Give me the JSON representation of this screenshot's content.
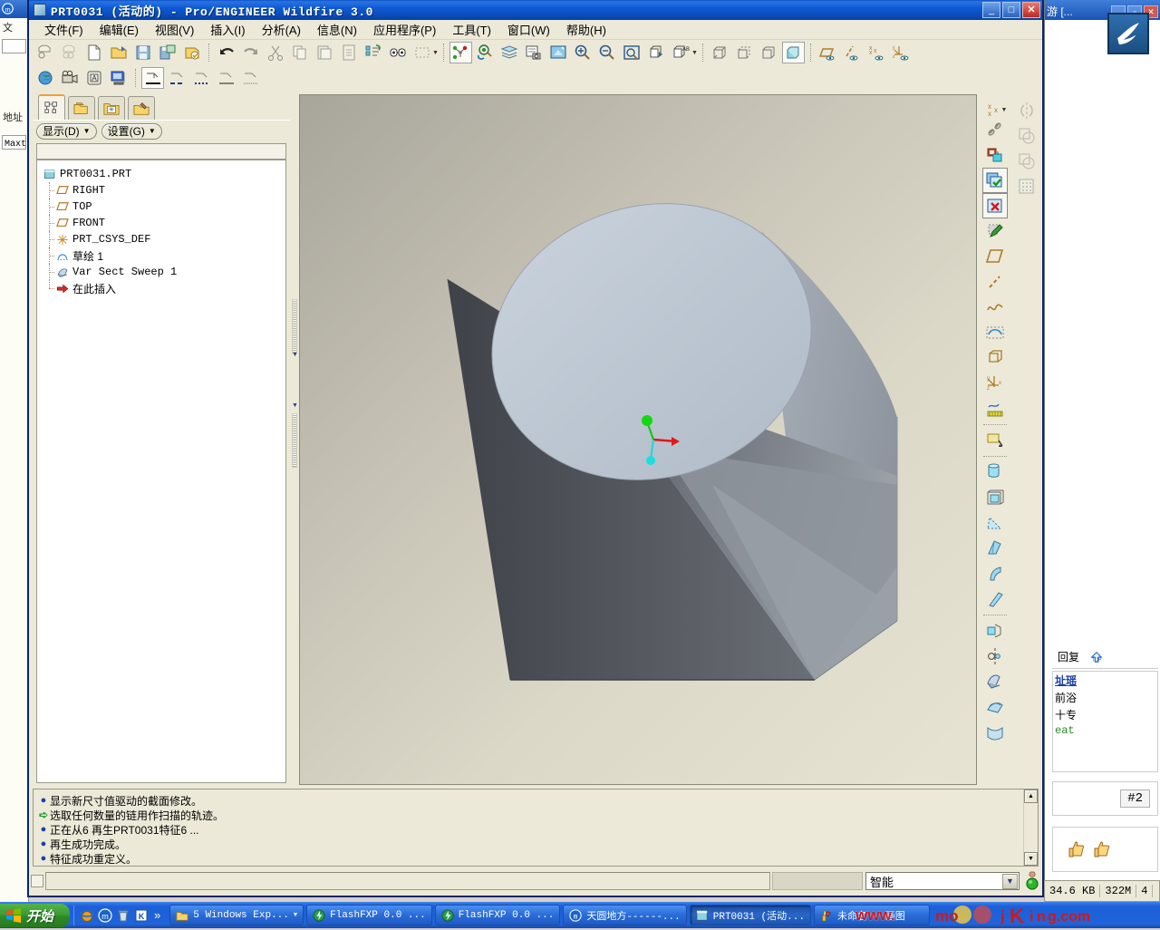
{
  "window": {
    "title": "PRT0031 (活动的) - Pro/ENGINEER Wildfire 3.0",
    "minimize_label": "_",
    "maximize_label": "□",
    "close_label": "✕",
    "icon": "proe-part-icon"
  },
  "menubar": {
    "items": [
      {
        "label": "文件(F)",
        "name": "menu-file"
      },
      {
        "label": "编辑(E)",
        "name": "menu-edit"
      },
      {
        "label": "视图(V)",
        "name": "menu-view"
      },
      {
        "label": "插入(I)",
        "name": "menu-insert"
      },
      {
        "label": "分析(A)",
        "name": "menu-analysis"
      },
      {
        "label": "信息(N)",
        "name": "menu-info"
      },
      {
        "label": "应用程序(P)",
        "name": "menu-applications"
      },
      {
        "label": "工具(T)",
        "name": "menu-tools"
      },
      {
        "label": "窗口(W)",
        "name": "menu-window"
      },
      {
        "label": "帮助(H)",
        "name": "menu-help"
      }
    ]
  },
  "toolbar_row1": {
    "icons": [
      "new-session-icon",
      "resume-session-icon",
      "new-file-icon",
      "open-file-icon",
      "save-file-icon",
      "save-a-copy-icon",
      "print-icon",
      "undo-icon",
      "redo-icon",
      "cut-icon",
      "copy-icon",
      "paste-icon",
      "paste-special-icon",
      "regenerate-icon",
      "find-icon",
      "select-box-icon",
      "datum-display-icon",
      "repaint-icon",
      "layers-icon",
      "model-player-icon",
      "screen-capture-icon",
      "zoom-in-icon",
      "zoom-out-icon",
      "refit-icon",
      "reorient-icon",
      "named-view-icon",
      "wireframe-icon",
      "hidden-line-icon",
      "no-hidden-icon",
      "shading-icon",
      "datum-plane-display-icon",
      "datum-axis-display-icon",
      "datum-point-display-icon",
      "datum-csys-display-icon"
    ]
  },
  "toolbar_row2": {
    "icons": [
      "appearance-icon",
      "animation-icon",
      "annotation-icon",
      "publish-icon",
      "line-style-solid-icon",
      "line-style-dash-icon",
      "line-style-dot-icon",
      "line-style-centerline-icon",
      "line-style-phantom-icon"
    ]
  },
  "tree": {
    "tabs": [
      {
        "name": "tab-model-tree",
        "icon": "model-tree-icon",
        "active": true
      },
      {
        "name": "tab-folder-browser",
        "icon": "folder-browser-icon",
        "active": false
      },
      {
        "name": "tab-favorites",
        "icon": "favorites-folder-icon",
        "active": false
      },
      {
        "name": "tab-connections",
        "icon": "tools-folder-icon",
        "active": false
      }
    ],
    "buttons": [
      {
        "label": "显示(D)",
        "name": "tree-show-button"
      },
      {
        "label": "设置(G)",
        "name": "tree-settings-button"
      }
    ],
    "nodes": [
      {
        "label": "PRT0031.PRT",
        "icon": "part-icon",
        "level": 0,
        "mono": true
      },
      {
        "label": "RIGHT",
        "icon": "datum-plane-icon",
        "level": 1,
        "mono": true
      },
      {
        "label": "TOP",
        "icon": "datum-plane-icon",
        "level": 1,
        "mono": true
      },
      {
        "label": "FRONT",
        "icon": "datum-plane-icon",
        "level": 1,
        "mono": true
      },
      {
        "label": "PRT_CSYS_DEF",
        "icon": "csys-icon",
        "level": 1,
        "mono": true
      },
      {
        "label": "草绘 1",
        "icon": "sketch-icon",
        "level": 1,
        "mono": false
      },
      {
        "label": "Var Sect Sweep 1",
        "icon": "sweep-icon",
        "level": 1,
        "mono": true
      },
      {
        "label": "在此插入",
        "icon": "insert-here-icon",
        "level": 1,
        "mono": false,
        "last": true
      }
    ]
  },
  "right_toolbar": {
    "icons": [
      "datum-point-icon",
      "chain-icon",
      "paint-icon",
      "check-regen-icon",
      "cancel-icon",
      "sketch-edit-icon",
      "datum-plane-create-icon",
      "datum-axis-create-icon",
      "curve-create-icon",
      "sketch-create-icon",
      "datum-plane-offset-icon",
      "coord-system-icon",
      "analysis-icon",
      "extrude-icon",
      "revolve-icon",
      "sweep-blend-icon",
      "variable-sweep-icon",
      "helical-sweep-icon",
      "blend-icon",
      "hole-icon",
      "shell-icon",
      "rib-icon",
      "draft-icon",
      "round-icon",
      "chamfer-icon"
    ]
  },
  "right_toolbar2": {
    "icons": [
      "mirror-icon",
      "merge-icon",
      "trim-icon",
      "pattern-icon"
    ]
  },
  "messages": {
    "lines": [
      {
        "bullet": "dot",
        "text": "显示新尺寸值驱动的截面修改。"
      },
      {
        "bullet": "arrow",
        "text": "选取任何数量的链用作扫描的轨迹。"
      },
      {
        "bullet": "dot",
        "text": "正在从6 再生PRT0031特征6 ..."
      },
      {
        "bullet": "dot",
        "text": "再生成功完成。"
      },
      {
        "bullet": "dot",
        "text": "特征成功重定义。"
      }
    ]
  },
  "statusbar": {
    "selection_filter": "智能",
    "dropdown_icon": "chevron-down-icon",
    "traffic_light_icon": "regeneration-status-icon"
  },
  "info_strip": {
    "fields": [
      "34.6 KB",
      "322M",
      "4"
    ]
  },
  "background_left": {
    "rows": [
      "文",
      "地址",
      "Maxt"
    ]
  },
  "background_right": {
    "title": "游 [...",
    "minimize": "_",
    "restore": "▫",
    "close": "✕",
    "reply_label": "回复",
    "top_label": "TOP",
    "post_number": "#2",
    "body_lines": [
      "址瑶",
      "前浴",
      "十专",
      "eat"
    ]
  },
  "taskbar": {
    "start_label": "开始",
    "quicklaunch": [
      "ie-icon",
      "maxthon-icon",
      "recycle-bin-icon",
      "editor-icon"
    ],
    "more_label": "»",
    "tasks": [
      {
        "label": "5 Windows Exp...",
        "icon": "folder-icon",
        "active": false,
        "caret": "▼"
      },
      {
        "label": "FlashFXP 0.0 ...",
        "icon": "flashfxp-icon",
        "active": false
      },
      {
        "label": "FlashFXP 0.0 ...",
        "icon": "flashfxp-icon",
        "active": false
      },
      {
        "label": "天圆地方------...",
        "icon": "maxthon-icon",
        "active": false
      },
      {
        "label": "PRT0031 (活动...",
        "icon": "proe-icon",
        "active": true
      },
      {
        "label": "未命名 - 画图",
        "icon": "paint-icon",
        "active": false
      }
    ],
    "watermark": "www.mojing.com"
  },
  "colors": {
    "title_blue": "#0a50c8",
    "face_gray": "#ece9d8",
    "graphics_bg": "#c8c4b6",
    "model_light": "#c0c8d2",
    "model_dark": "#53565c",
    "accent_green": "#1a9a2a"
  }
}
